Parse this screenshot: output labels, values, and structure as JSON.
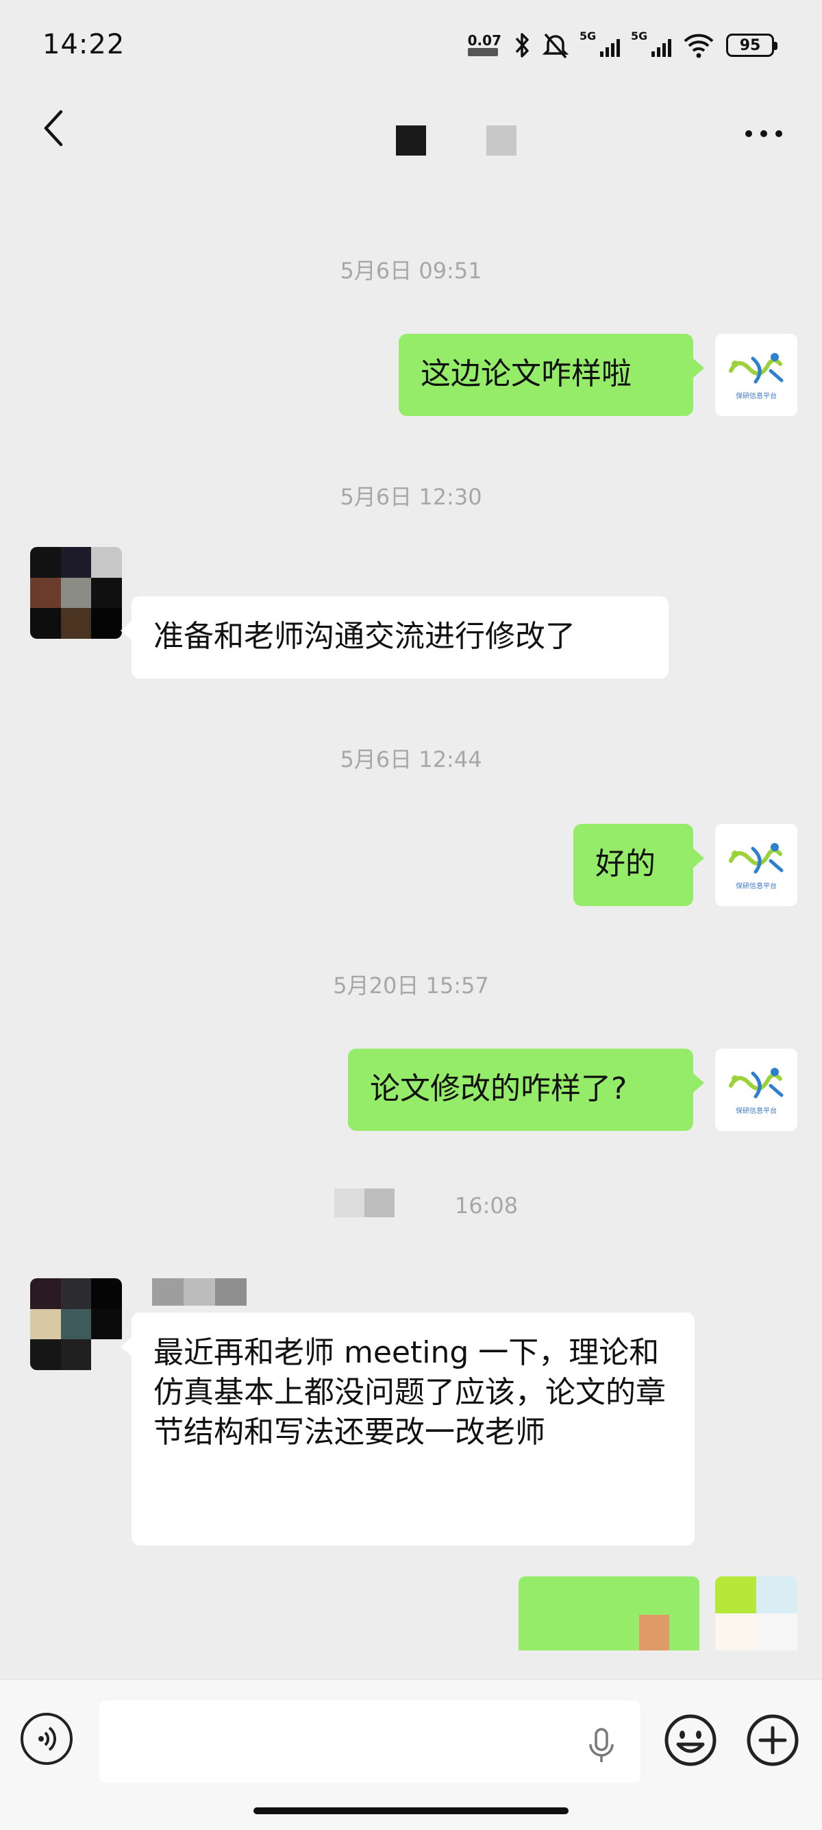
{
  "status_bar": {
    "time": "14:22",
    "net_speed": "0.07",
    "sim1_label": "5G",
    "sim2_label": "5G",
    "battery": "95"
  },
  "header": {
    "title_colors": [
      "#1a1a1a",
      "#c8c8c8"
    ]
  },
  "messages": [
    {
      "type": "timestamp",
      "text": "5月6日 09:51"
    },
    {
      "type": "out",
      "text": "这边论文咋样啦"
    },
    {
      "type": "timestamp",
      "text": "5月6日 12:30"
    },
    {
      "type": "in",
      "text": "准备和老师沟通交流进行修改了"
    },
    {
      "type": "timestamp",
      "text": "5月6日 12:44"
    },
    {
      "type": "out",
      "text": "好的"
    },
    {
      "type": "timestamp",
      "text": "5月20日 15:57"
    },
    {
      "type": "out",
      "text": "论文修改的咋样了?"
    },
    {
      "type": "timestamp",
      "text": "16:08"
    },
    {
      "type": "in",
      "text": "最近再和老师 meeting 一下，理论和仿真基本上都没问题了应该，论文的章节结构和写法还要改一改老师"
    }
  ],
  "self_avatar": {
    "icon": "research-platform-logo-icon",
    "caption": "保研信息平台",
    "colors": [
      "#9bd23b",
      "#2f7fd1"
    ]
  },
  "contact_avatar_colors": [
    "#121212",
    "#1d1b2a",
    "#c7c7c7",
    "#6b3b2b",
    "#8c8c86",
    "#101010",
    "#0e0e0e",
    "#4a3421",
    "#050505"
  ],
  "contact2_avatar_colors": [
    "#2a1a22",
    "#2b2b30",
    "#050505",
    "#d8c9a4",
    "#3f5a5a",
    "#0b0b0b",
    "#161616",
    "#202020",
    "#ededed"
  ],
  "colors": {
    "out_bubble": "#95ec69",
    "in_bubble": "#ffffff",
    "background": "#ededed",
    "timestamp": "#a7a7a7"
  },
  "input_bar": {
    "placeholder": "",
    "icons": [
      "voice-icon",
      "microphone-icon",
      "emoji-icon",
      "plus-icon"
    ]
  }
}
